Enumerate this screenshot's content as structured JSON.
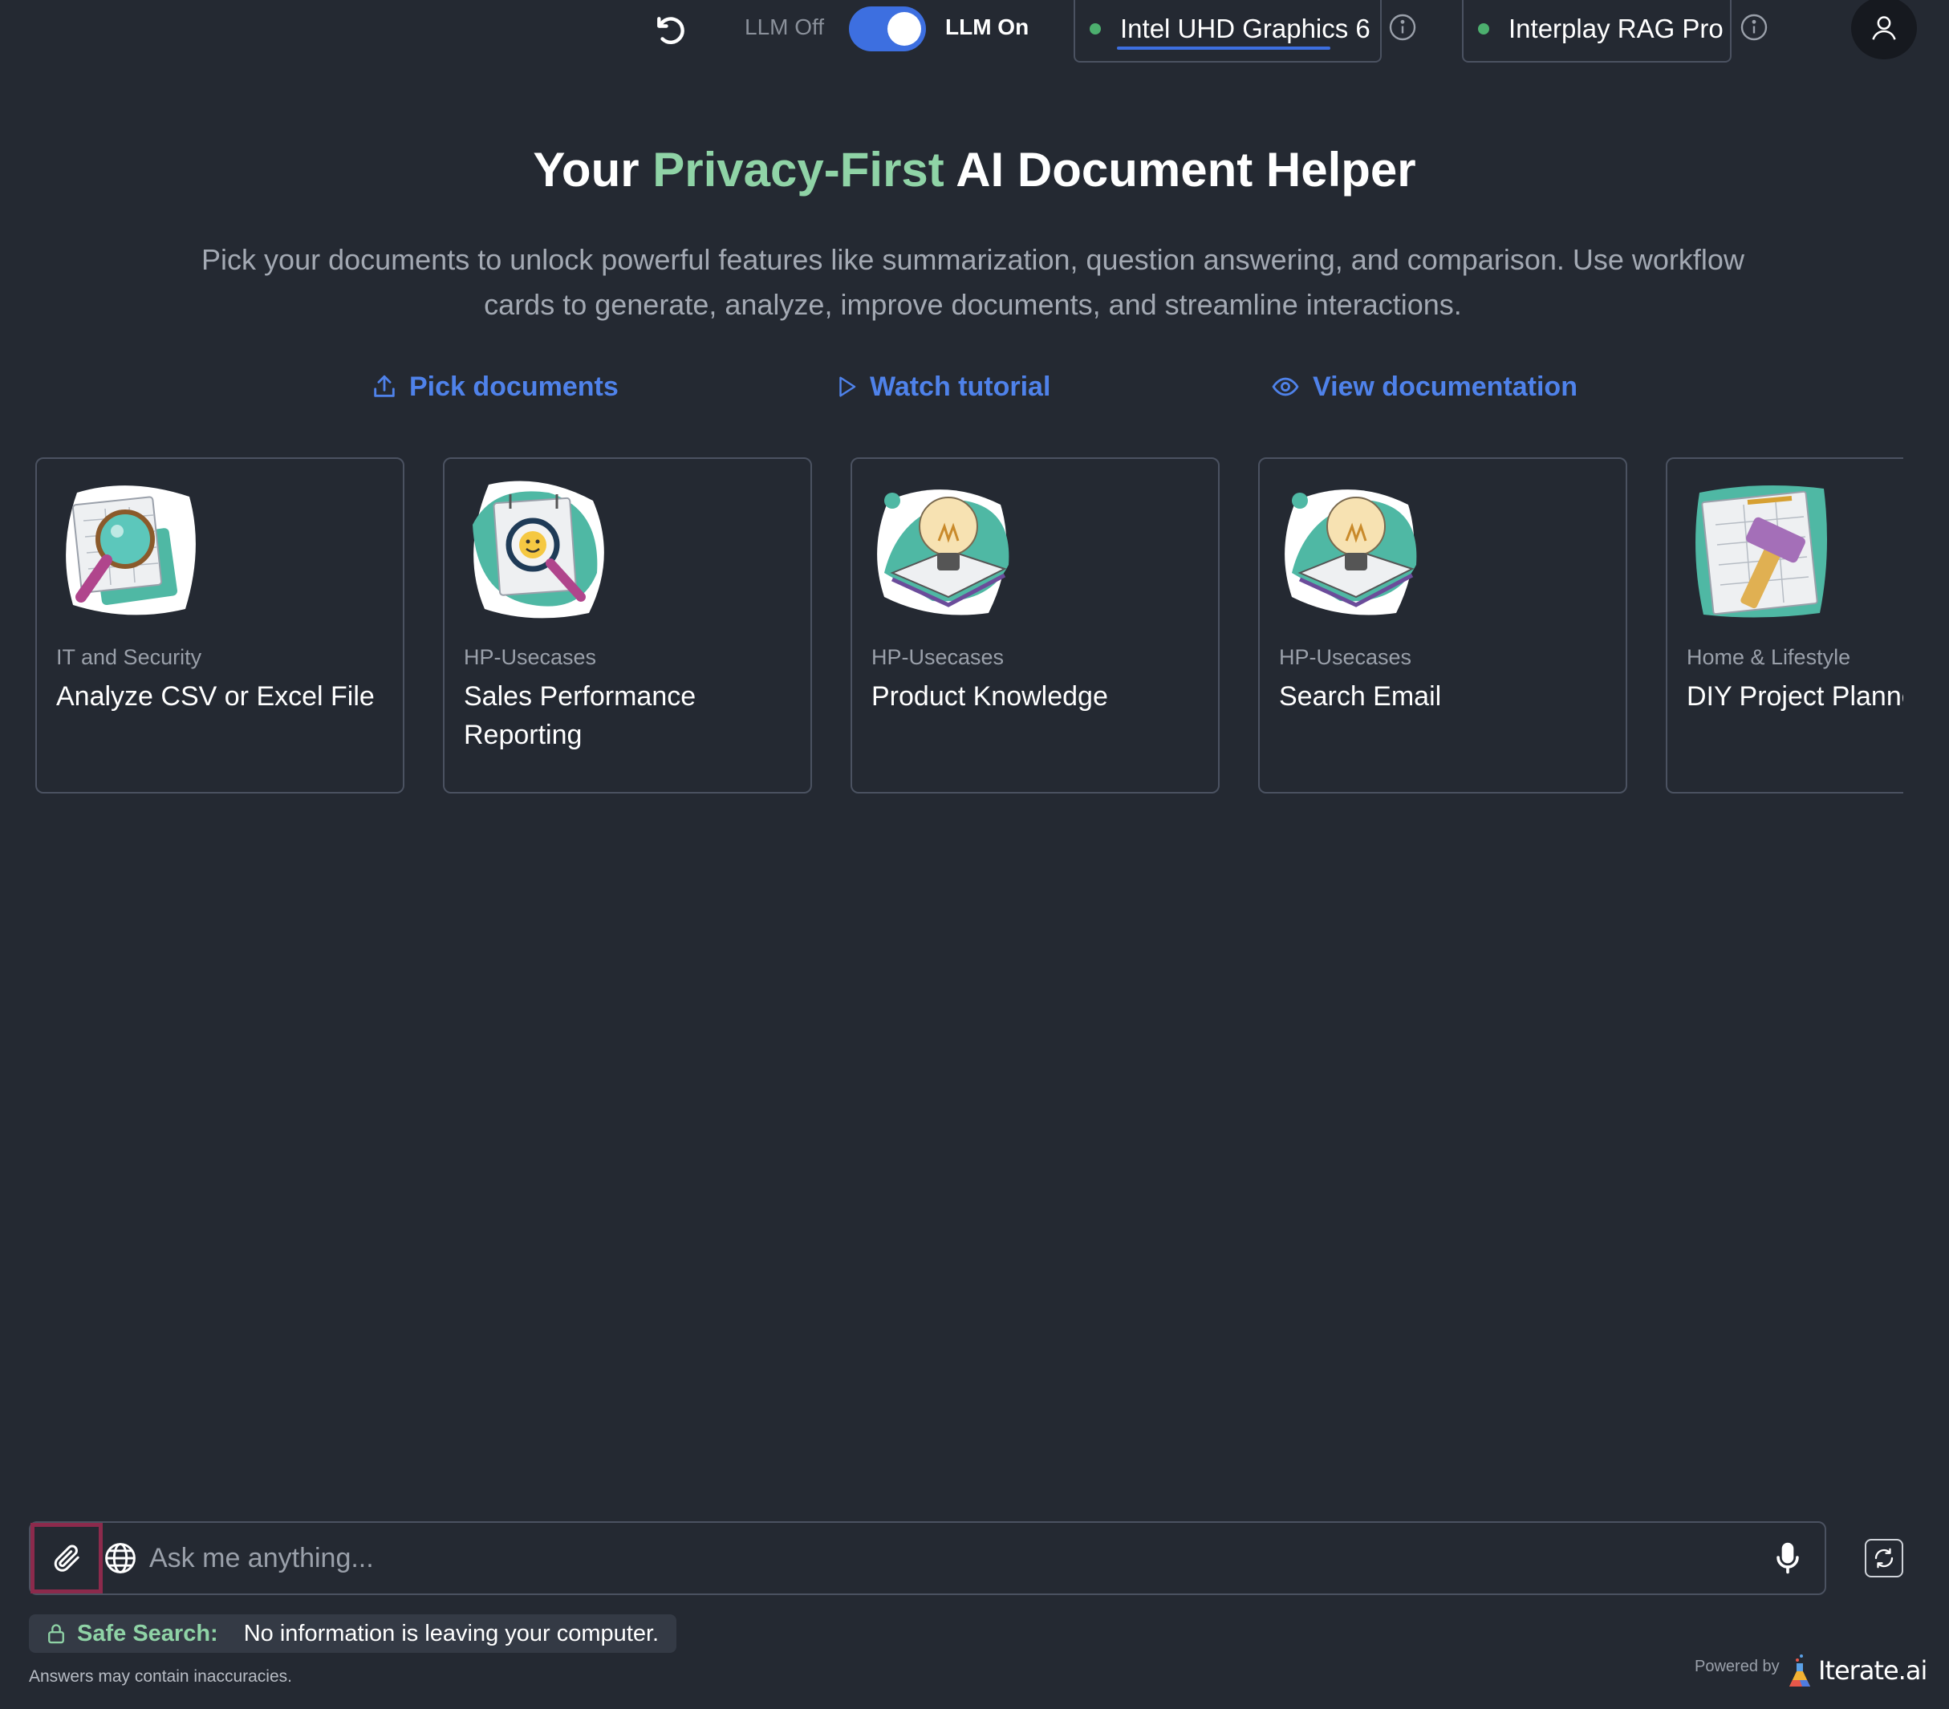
{
  "topbar": {
    "llm_off_label": "LLM Off",
    "llm_on_label": "LLM On",
    "llm_enabled": true,
    "device_model": "Intel UHD Graphics 6",
    "rag_model": "Interplay RAG Pro",
    "status_color": "#4caf6e",
    "toggle_color": "#3d6fe0"
  },
  "hero": {
    "title_prefix": "Your ",
    "title_accent": "Privacy-First",
    "title_suffix": " AI Document Helper",
    "accent_color": "#8fd3a6",
    "subtitle": "Pick your documents to unlock powerful features like summarization, question answering, and comparison. Use workflow cards to generate, analyze, improve documents, and streamline interactions."
  },
  "actions": {
    "pick_documents": "Pick documents",
    "watch_tutorial": "Watch tutorial",
    "view_documentation": "View documentation",
    "link_color": "#4f82ea"
  },
  "cards": [
    {
      "category": "IT and Security",
      "title": "Analyze CSV or Excel File",
      "icon": "magnifier-spreadsheet-illustration"
    },
    {
      "category": "HP-Usecases",
      "title": "Sales Performance Reporting",
      "icon": "magnifier-smiley-illustration"
    },
    {
      "category": "HP-Usecases",
      "title": "Product Knowledge",
      "icon": "lightbulb-book-illustration"
    },
    {
      "category": "HP-Usecases",
      "title": "Search Email",
      "icon": "lightbulb-book-illustration"
    },
    {
      "category": "Home & Lifestyle",
      "title": "DIY Project Planner",
      "icon": "hammer-blueprint-illustration"
    }
  ],
  "chat": {
    "placeholder": "Ask me anything..."
  },
  "footer": {
    "safe_search_label": "Safe Search:",
    "safe_search_message": "No information is leaving your computer.",
    "disclaimer": "Answers may contain inaccuracies.",
    "powered_by": "Powered by",
    "brand": "Iterate.ai"
  }
}
